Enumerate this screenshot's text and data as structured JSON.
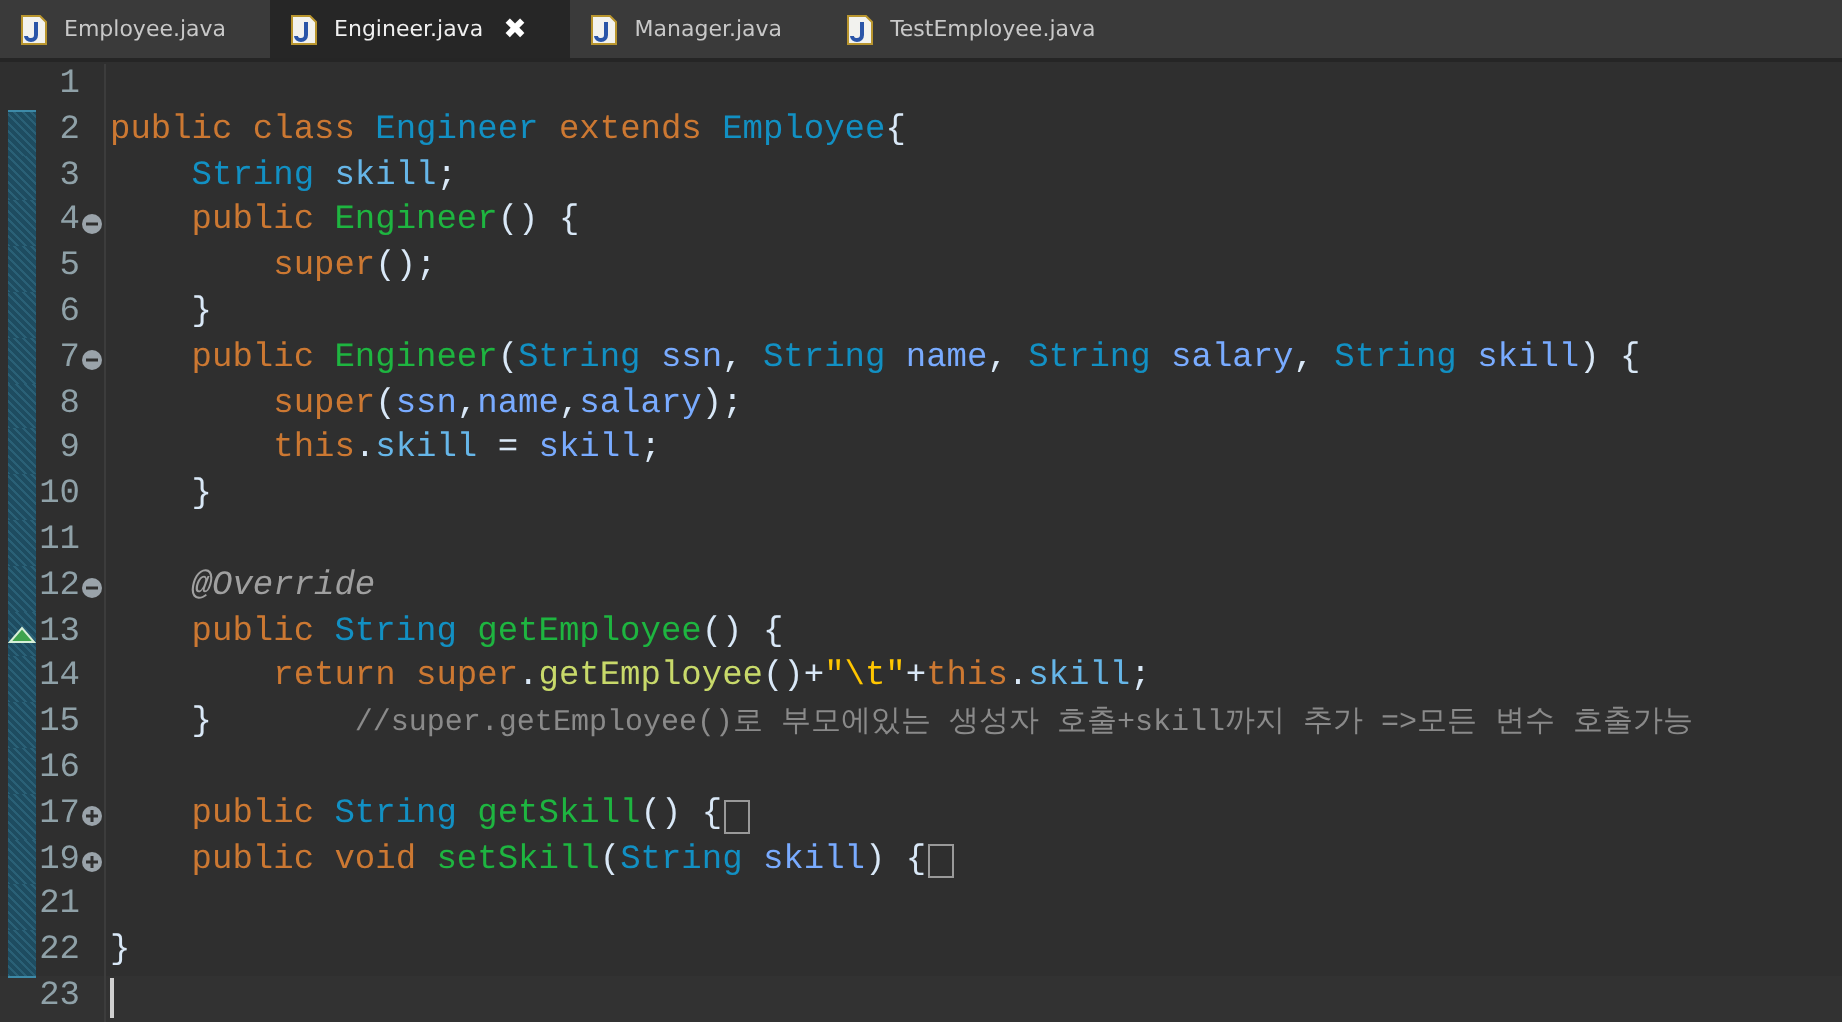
{
  "tabs": [
    {
      "label": "Employee.java",
      "selected": false
    },
    {
      "label": "Engineer.java",
      "selected": true,
      "close": "✖"
    },
    {
      "label": "Manager.java",
      "selected": false
    },
    {
      "label": "TestEmployee.java",
      "selected": false
    }
  ],
  "lines": [
    {
      "number": "1",
      "changed": false
    },
    {
      "number": "2",
      "changed": true,
      "tokens": [
        {
          "kind": "keyword",
          "text": "public "
        },
        {
          "kind": "keyword",
          "text": "class "
        },
        {
          "kind": "classname",
          "text": "Engineer "
        },
        {
          "kind": "keyword",
          "text": "extends "
        },
        {
          "kind": "classname",
          "text": "Employee"
        },
        {
          "kind": "plain",
          "text": "{"
        }
      ]
    },
    {
      "number": "3",
      "changed": true,
      "tokens": [
        {
          "kind": "type",
          "text": "    String "
        },
        {
          "kind": "field",
          "text": "skill"
        },
        {
          "kind": "plain",
          "text": ";"
        }
      ]
    },
    {
      "number": "4",
      "changed": true,
      "fold": {
        "kind": "collapse"
      },
      "tokens": [
        {
          "kind": "keyword",
          "text": "    public "
        },
        {
          "kind": "method",
          "text": "Engineer"
        },
        {
          "kind": "plain",
          "text": "() {"
        }
      ]
    },
    {
      "number": "5",
      "changed": true,
      "tokens": [
        {
          "kind": "keyword",
          "text": "        super"
        },
        {
          "kind": "plain",
          "text": "();"
        }
      ]
    },
    {
      "number": "6",
      "changed": true,
      "tokens": [
        {
          "kind": "plain",
          "text": "    }"
        }
      ]
    },
    {
      "number": "7",
      "changed": true,
      "fold": {
        "kind": "collapse"
      },
      "tokens": [
        {
          "kind": "keyword",
          "text": "    public "
        },
        {
          "kind": "method",
          "text": "Engineer"
        },
        {
          "kind": "plain",
          "text": "("
        },
        {
          "kind": "type",
          "text": "String "
        },
        {
          "kind": "param",
          "text": "ssn"
        },
        {
          "kind": "plain",
          "text": ", "
        },
        {
          "kind": "type",
          "text": "String "
        },
        {
          "kind": "param",
          "text": "name"
        },
        {
          "kind": "plain",
          "text": ", "
        },
        {
          "kind": "type",
          "text": "String "
        },
        {
          "kind": "param",
          "text": "salary"
        },
        {
          "kind": "plain",
          "text": ", "
        },
        {
          "kind": "type",
          "text": "String "
        },
        {
          "kind": "param",
          "text": "skill"
        },
        {
          "kind": "plain",
          "text": ") {"
        }
      ]
    },
    {
      "number": "8",
      "changed": true,
      "tokens": [
        {
          "kind": "keyword",
          "text": "        super"
        },
        {
          "kind": "plain",
          "text": "("
        },
        {
          "kind": "param",
          "text": "ssn"
        },
        {
          "kind": "plain",
          "text": ","
        },
        {
          "kind": "param",
          "text": "name"
        },
        {
          "kind": "plain",
          "text": ","
        },
        {
          "kind": "param",
          "text": "salary"
        },
        {
          "kind": "plain",
          "text": ");"
        }
      ]
    },
    {
      "number": "9",
      "changed": true,
      "tokens": [
        {
          "kind": "keyword",
          "text": "        this"
        },
        {
          "kind": "plain",
          "text": "."
        },
        {
          "kind": "field",
          "text": "skill"
        },
        {
          "kind": "plain",
          "text": " = "
        },
        {
          "kind": "param",
          "text": "skill"
        },
        {
          "kind": "plain",
          "text": ";"
        }
      ]
    },
    {
      "number": "10",
      "changed": true,
      "tokens": [
        {
          "kind": "plain",
          "text": "    }"
        }
      ]
    },
    {
      "number": "11",
      "changed": true
    },
    {
      "number": "12",
      "changed": true,
      "fold": {
        "kind": "collapse"
      },
      "tokens": [
        {
          "kind": "annotation",
          "text": "    @Override"
        }
      ]
    },
    {
      "number": "13",
      "changed": true,
      "marker": {
        "kind": "override"
      },
      "tokens": [
        {
          "kind": "keyword",
          "text": "    public "
        },
        {
          "kind": "type",
          "text": "String "
        },
        {
          "kind": "method",
          "text": "getEmployee"
        },
        {
          "kind": "plain",
          "text": "() {"
        }
      ]
    },
    {
      "number": "14",
      "changed": true,
      "tokens": [
        {
          "kind": "keyword",
          "text": "        return "
        },
        {
          "kind": "keyword",
          "text": "super"
        },
        {
          "kind": "plain",
          "text": "."
        },
        {
          "kind": "call",
          "text": "getEmployee"
        },
        {
          "kind": "plain",
          "text": "()+"
        },
        {
          "kind": "string",
          "text": "\"\\t\""
        },
        {
          "kind": "plain",
          "text": "+"
        },
        {
          "kind": "keyword",
          "text": "this"
        },
        {
          "kind": "plain",
          "text": "."
        },
        {
          "kind": "field",
          "text": "skill"
        },
        {
          "kind": "plain",
          "text": ";"
        }
      ]
    },
    {
      "number": "15",
      "changed": true,
      "tokens": [
        {
          "kind": "plain",
          "text": "    }       "
        },
        {
          "kind": "comment",
          "text": "//super.getEmployee()로 부모에있는 생성자 호출+skill까지 추가 =>모든 변수 호출가능"
        }
      ]
    },
    {
      "number": "16",
      "changed": true
    },
    {
      "number": "17",
      "changed": true,
      "fold": {
        "kind": "expand"
      },
      "tokens": [
        {
          "kind": "keyword",
          "text": "    public "
        },
        {
          "kind": "type",
          "text": "String "
        },
        {
          "kind": "method",
          "text": "getSkill"
        },
        {
          "kind": "plain",
          "text": "() {"
        },
        {
          "kind": "folded"
        }
      ]
    },
    {
      "number": "19",
      "changed": true,
      "fold": {
        "kind": "expand"
      },
      "tokens": [
        {
          "kind": "keyword",
          "text": "    public "
        },
        {
          "kind": "keyword",
          "text": "void "
        },
        {
          "kind": "method",
          "text": "setSkill"
        },
        {
          "kind": "plain",
          "text": "("
        },
        {
          "kind": "type",
          "text": "String "
        },
        {
          "kind": "param",
          "text": "skill"
        },
        {
          "kind": "plain",
          "text": ") {"
        },
        {
          "kind": "folded"
        }
      ]
    },
    {
      "number": "21",
      "changed": true
    },
    {
      "number": "22",
      "changed": true,
      "tokens": [
        {
          "kind": "plain",
          "text": "}"
        }
      ]
    },
    {
      "number": "23",
      "changed": false,
      "current": true
    }
  ]
}
